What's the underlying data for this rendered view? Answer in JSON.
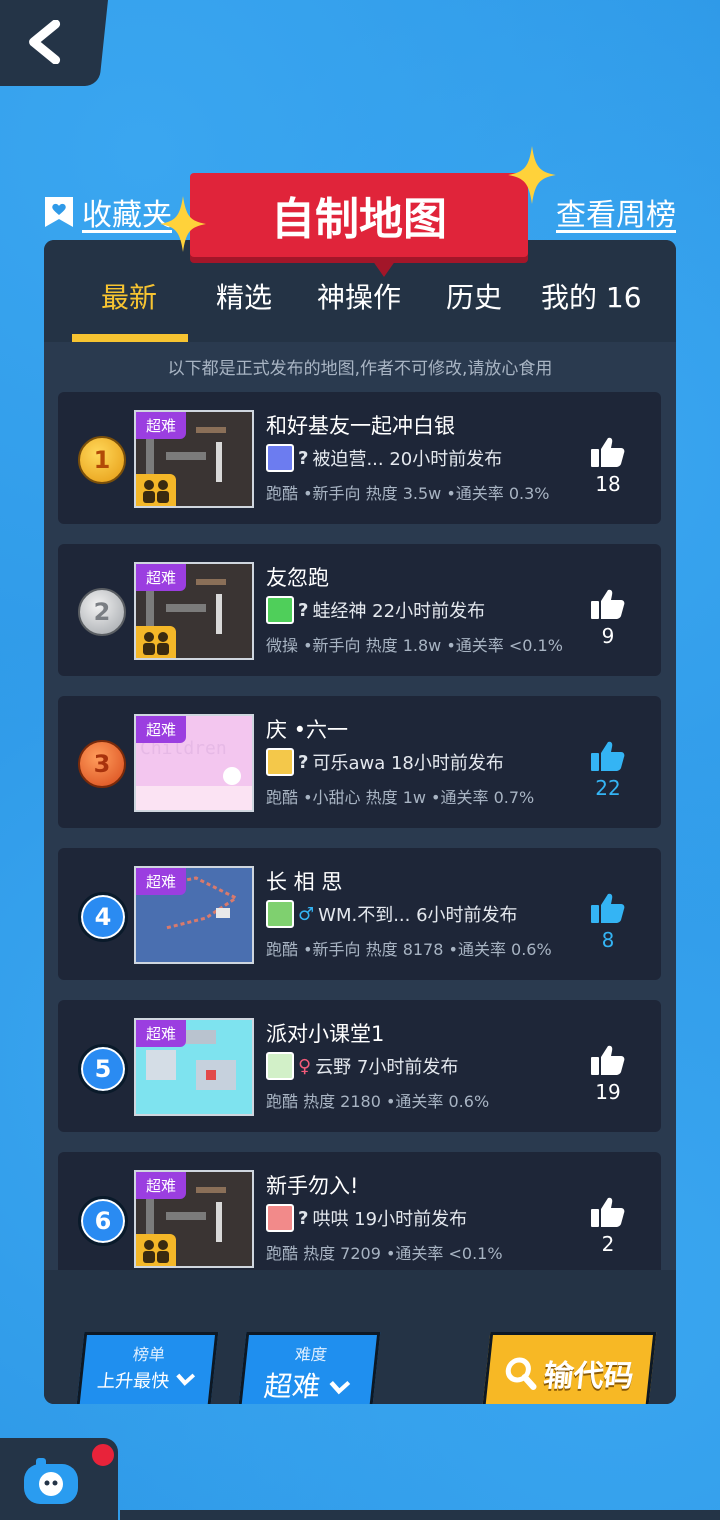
{
  "header": {
    "favorites_label": "收藏夹",
    "title": "自制地图",
    "weekly_label": "查看周榜"
  },
  "tabs": [
    {
      "label": "最新",
      "active": true
    },
    {
      "label": "精选",
      "active": false
    },
    {
      "label": "神操作",
      "active": false
    },
    {
      "label": "历史",
      "active": false
    },
    {
      "label": "我的 16",
      "active": false
    }
  ],
  "notice": "以下都是正式发布的地图,作者不可修改,请放心食用",
  "maps": [
    {
      "rank": "1",
      "rank_style": "gold",
      "badge": "超难",
      "coop": true,
      "thumb_color": "#3a3433",
      "name": "和好基友一起冲白银",
      "author_gender": "?",
      "author": "被迫营... 20小时前发布",
      "stats": "跑酷 •新手向 热度 3.5w •通关率 0.3%",
      "likes": "18",
      "liked": false
    },
    {
      "rank": "2",
      "rank_style": "silver",
      "badge": "超难",
      "coop": true,
      "thumb_color": "#3a3433",
      "name": "友忽跑",
      "author_gender": "?",
      "author": "蛙经神 22小时前发布",
      "stats": "微操 •新手向 热度 1.8w •通关率 <0.1%",
      "likes": "9",
      "liked": false
    },
    {
      "rank": "3",
      "rank_style": "bronze",
      "badge": "超难",
      "coop": false,
      "thumb_color": "#f3c6ef",
      "name": "庆 •六一",
      "author_gender": "?",
      "author": "可乐awa 18小时前发布",
      "stats": "跑酷 •小甜心 热度 1w •通关率 0.7%",
      "likes": "22",
      "liked": true
    },
    {
      "rank": "4",
      "rank_style": "blue",
      "badge": "超难",
      "coop": false,
      "thumb_color": "#4a6fb0",
      "name": "长 相 思",
      "author_gender": "♂",
      "author": "WM.不到... 6小时前发布",
      "stats": "跑酷 •新手向 热度 8178 •通关率 0.6%",
      "likes": "8",
      "liked": true
    },
    {
      "rank": "5",
      "rank_style": "blue",
      "badge": "超难",
      "coop": false,
      "thumb_color": "#7ee3ef",
      "name": "派对小课堂1",
      "author_gender": "♀",
      "author": "云野 7小时前发布",
      "stats": "跑酷 热度 2180 •通关率 0.6%",
      "likes": "19",
      "liked": false
    },
    {
      "rank": "6",
      "rank_style": "blue",
      "badge": "超难",
      "coop": true,
      "thumb_color": "#3a3433",
      "name": "新手勿入!",
      "author_gender": "?",
      "author": "哄哄 19小时前发布",
      "stats": "跑酷 热度 7209 •通关率 <0.1%",
      "likes": "2",
      "liked": false
    }
  ],
  "bottom": {
    "ranking_label": "榜单",
    "ranking_value": "上升最快",
    "difficulty_label": "难度",
    "difficulty_value": "超难",
    "code_label": "输代码"
  },
  "colors": {
    "accent": "#f7c431",
    "liked": "#34b4f4",
    "badge": "#9b3ee0"
  }
}
